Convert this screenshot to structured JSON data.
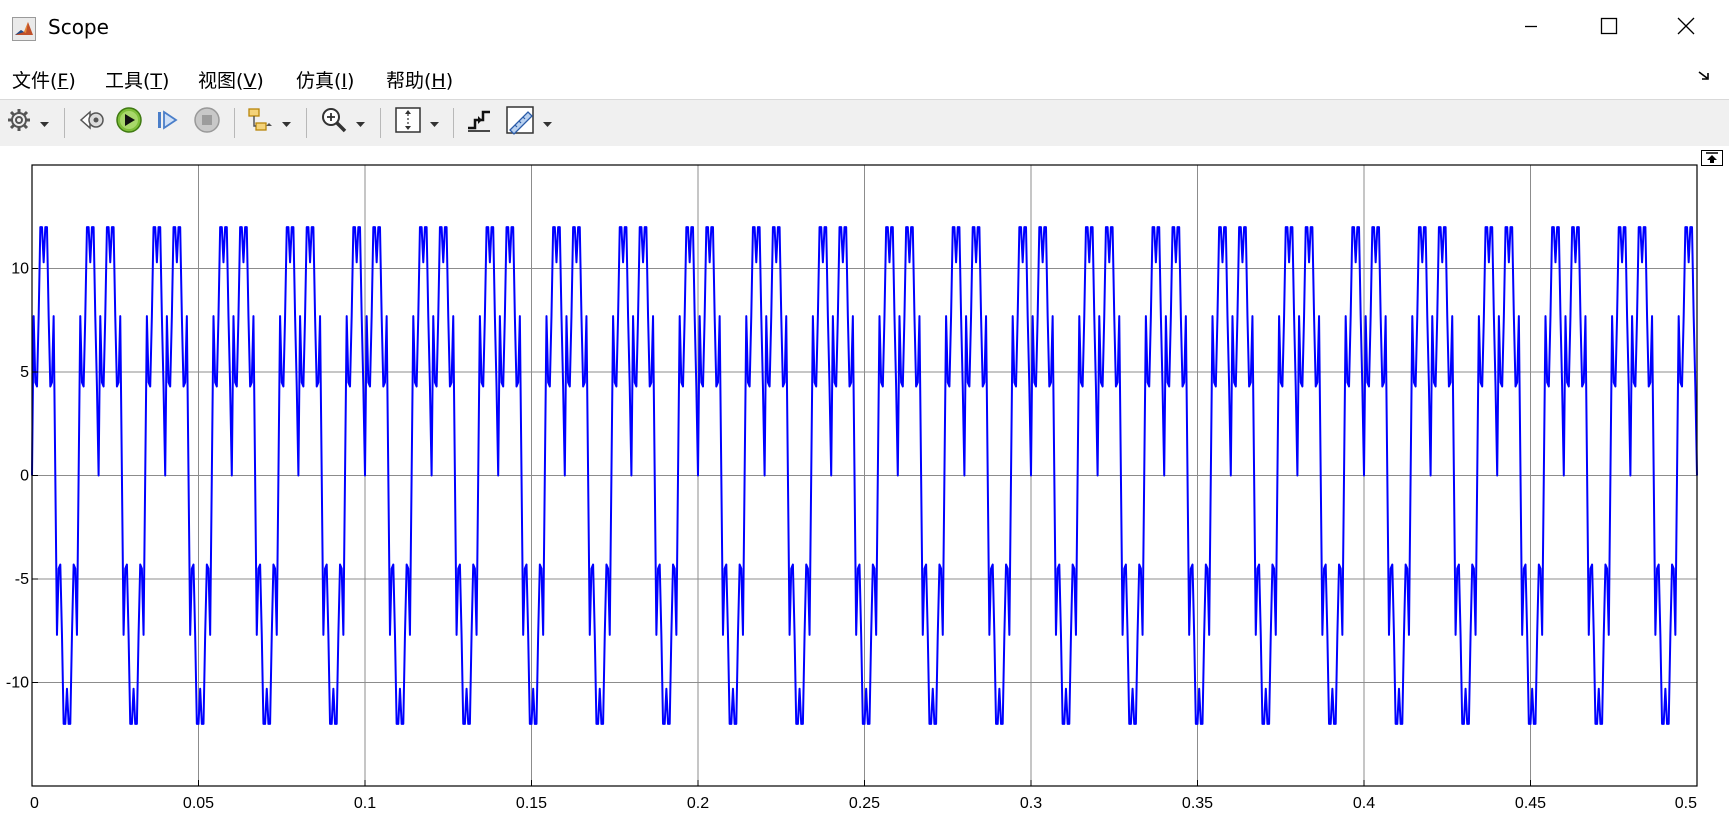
{
  "window": {
    "title": "Scope",
    "app_icon": "matlab-icon",
    "controls": [
      "minimize-icon",
      "maximize-icon",
      "close-icon"
    ]
  },
  "menu": [
    {
      "text": "文件(",
      "key": "F",
      "end": ")"
    },
    {
      "text": "工具(",
      "key": "T",
      "end": ")"
    },
    {
      "text": "视图(",
      "key": "V",
      "end": ")"
    },
    {
      "text": "仿真(",
      "key": "I",
      "end": ")"
    },
    {
      "text": "帮助(",
      "key": "H",
      "end": ")"
    }
  ],
  "toolbar_icons": [
    "settings-gear-icon",
    "step-back-icon",
    "run-icon",
    "step-forward-icon",
    "stop-icon",
    "highlight-block-icon",
    "zoom-in-icon",
    "scale-axes-icon",
    "triggers-icon",
    "cursor-measurements-icon"
  ],
  "chart_data": {
    "type": "line",
    "title": "",
    "xlabel": "",
    "ylabel": "",
    "xlim": [
      0,
      0.5
    ],
    "ylim": [
      -15,
      15
    ],
    "xticks": [
      "0",
      "0.05",
      "0.1",
      "0.15",
      "0.2",
      "0.25",
      "0.3",
      "0.35",
      "0.4",
      "0.45",
      "0.5"
    ],
    "xtick_values": [
      0,
      0.05,
      0.1,
      0.15,
      0.2,
      0.25,
      0.3,
      0.35,
      0.4,
      0.45,
      0.5
    ],
    "yticks": [
      "10",
      "5",
      "0",
      "-5",
      "-10"
    ],
    "ytick_values": [
      10,
      5,
      0,
      -5,
      -10
    ],
    "grid": true,
    "series": [
      {
        "color": "#0000ff",
        "period": 0.02,
        "x": [
          0,
          0.0005,
          0.001,
          0.0015,
          0.002,
          0.0025,
          0.003,
          0.0035,
          0.004,
          0.0045,
          0.005,
          0.0055,
          0.006,
          0.0065,
          0.007,
          0.0075,
          0.008,
          0.0085,
          0.009,
          0.0095,
          0.01,
          0.0105,
          0.011,
          0.0115,
          0.012,
          0.0125,
          0.013,
          0.0135,
          0.014,
          0.0145,
          0.015,
          0.0155,
          0.016,
          0.0165,
          0.017,
          0.0175,
          0.018,
          0.0185,
          0.019,
          0.0195
        ],
        "y": [
          0,
          7.7,
          4.5,
          4.3,
          7.7,
          12.0,
          12.0,
          10.3,
          12.0,
          12.0,
          7.7,
          4.3,
          4.5,
          7.7,
          0,
          -7.7,
          -4.5,
          -4.3,
          -7.7,
          -12.0,
          -12.0,
          -10.3,
          -12.0,
          -12.0,
          -7.7,
          -4.3,
          -4.5,
          -7.7,
          0,
          7.7,
          4.5,
          4.3,
          7.7,
          12.0,
          12.0,
          10.3,
          12.0,
          12.0,
          7.7,
          4.3
        ]
      }
    ]
  }
}
